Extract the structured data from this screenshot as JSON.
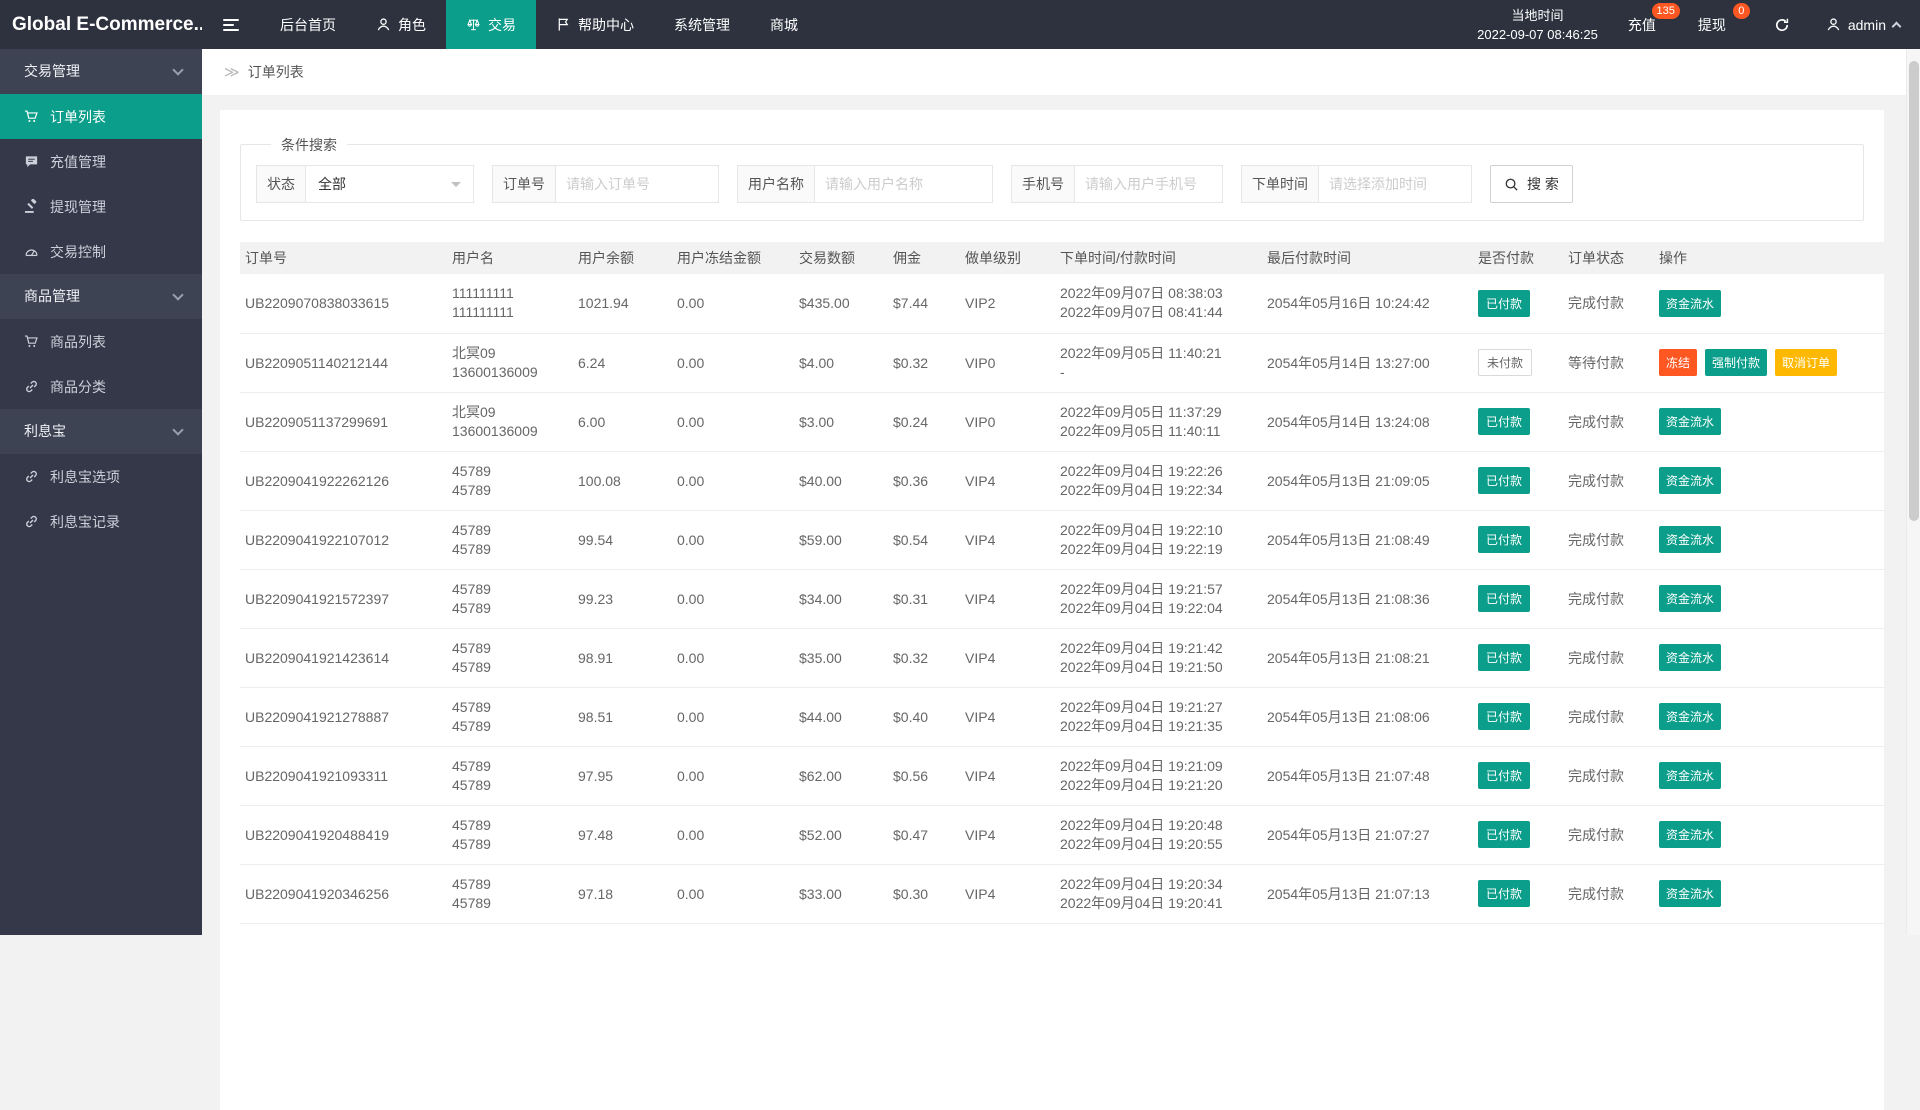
{
  "brand": "Global E-Commerce...",
  "colors": {
    "accent": "#0b9e8a",
    "danger": "#ff5722",
    "warning": "#ffb800",
    "header_bg": "#2d323e",
    "sidebar_bg": "#343848",
    "sidebar_group_bg": "#3e4354"
  },
  "topnav": {
    "items": [
      {
        "name": "dashboard",
        "label": "后台首页"
      },
      {
        "name": "roles",
        "label": "角色",
        "icon": "user"
      },
      {
        "name": "trade",
        "label": "交易",
        "icon": "scales",
        "active": true
      },
      {
        "name": "help-center",
        "label": "帮助中心",
        "icon": "flag"
      },
      {
        "name": "system",
        "label": "系统管理"
      },
      {
        "name": "mall",
        "label": "商城"
      }
    ],
    "local_time_label": "当地时间",
    "local_time": "2022-09-07 08:46:25",
    "recharge": {
      "label": "充值",
      "badge": "135"
    },
    "withdraw": {
      "label": "提现",
      "badge": "0"
    },
    "user": "admin"
  },
  "sidebar": {
    "items": [
      {
        "kind": "group",
        "name": "trade-management",
        "label": "交易管理"
      },
      {
        "kind": "leaf",
        "name": "order-list",
        "label": "订单列表",
        "icon": "cart",
        "active": true
      },
      {
        "kind": "leaf",
        "name": "recharge-management",
        "label": "充值管理",
        "icon": "comment"
      },
      {
        "kind": "leaf",
        "name": "withdraw-management",
        "label": "提现管理",
        "icon": "hammer"
      },
      {
        "kind": "leaf",
        "name": "trade-control",
        "label": "交易控制",
        "icon": "gauge"
      },
      {
        "kind": "group",
        "name": "goods-management",
        "label": "商品管理"
      },
      {
        "kind": "leaf",
        "name": "goods-list",
        "label": "商品列表",
        "icon": "cart"
      },
      {
        "kind": "leaf",
        "name": "goods-category",
        "label": "商品分类",
        "icon": "link"
      },
      {
        "kind": "group",
        "name": "interest-treasure",
        "label": "利息宝"
      },
      {
        "kind": "leaf",
        "name": "interest-options",
        "label": "利息宝选项",
        "icon": "link"
      },
      {
        "kind": "leaf",
        "name": "interest-records",
        "label": "利息宝记录",
        "icon": "link"
      }
    ]
  },
  "breadcrumb": "订单列表",
  "filters": {
    "legend": "条件搜索",
    "status_label": "状态",
    "status_value": "全部",
    "order_label": "订单号",
    "order_placeholder": "请输入订单号",
    "user_label": "用户名称",
    "user_placeholder": "请输入用户名称",
    "phone_label": "手机号",
    "phone_placeholder": "请输入用户手机号",
    "time_label": "下单时间",
    "time_placeholder": "请选择添加时间",
    "search_label": "搜 索"
  },
  "table": {
    "columns": [
      "订单号",
      "用户名",
      "用户余额",
      "用户冻结金额",
      "交易数额",
      "佣金",
      "做单级别",
      "下单时间/付款时间",
      "最后付款时间",
      "是否付款",
      "订单状态",
      "操作"
    ],
    "paid_labels": {
      "paid": "已付款",
      "unpaid": "未付款"
    },
    "rows": [
      {
        "order_no": "UB2209070838033615",
        "user": [
          "111111111",
          "111111111"
        ],
        "balance": "1021.94",
        "frozen": "0.00",
        "amount": "$435.00",
        "commission": "$7.44",
        "level": "VIP2",
        "times": [
          "2022年09月07日 08:38:03",
          "2022年09月07日 08:41:44"
        ],
        "last_pay": "2054年05月16日 10:24:42",
        "paid": "paid",
        "status": "完成付款",
        "actions": [
          {
            "name": "funds-flow",
            "label": "资金流水",
            "color": "teal"
          }
        ]
      },
      {
        "order_no": "UB2209051140212144",
        "user": [
          "北冥09",
          "13600136009"
        ],
        "balance": "6.24",
        "frozen": "0.00",
        "amount": "$4.00",
        "commission": "$0.32",
        "level": "VIP0",
        "times": [
          "2022年09月05日 11:40:21",
          "-"
        ],
        "last_pay": "2054年05月14日 13:27:00",
        "paid": "unpaid",
        "status": "等待付款",
        "actions": [
          {
            "name": "freeze",
            "label": "冻结",
            "color": "red"
          },
          {
            "name": "force-pay",
            "label": "强制付款",
            "color": "teal"
          },
          {
            "name": "cancel-order",
            "label": "取消订单",
            "color": "yellow"
          }
        ]
      },
      {
        "order_no": "UB2209051137299691",
        "user": [
          "北冥09",
          "13600136009"
        ],
        "balance": "6.00",
        "frozen": "0.00",
        "amount": "$3.00",
        "commission": "$0.24",
        "level": "VIP0",
        "times": [
          "2022年09月05日 11:37:29",
          "2022年09月05日 11:40:11"
        ],
        "last_pay": "2054年05月14日 13:24:08",
        "paid": "paid",
        "status": "完成付款",
        "actions": [
          {
            "name": "funds-flow",
            "label": "资金流水",
            "color": "teal"
          }
        ]
      },
      {
        "order_no": "UB2209041922262126",
        "user": [
          "45789",
          "45789"
        ],
        "balance": "100.08",
        "frozen": "0.00",
        "amount": "$40.00",
        "commission": "$0.36",
        "level": "VIP4",
        "times": [
          "2022年09月04日 19:22:26",
          "2022年09月04日 19:22:34"
        ],
        "last_pay": "2054年05月13日 21:09:05",
        "paid": "paid",
        "status": "完成付款",
        "actions": [
          {
            "name": "funds-flow",
            "label": "资金流水",
            "color": "teal"
          }
        ]
      },
      {
        "order_no": "UB2209041922107012",
        "user": [
          "45789",
          "45789"
        ],
        "balance": "99.54",
        "frozen": "0.00",
        "amount": "$59.00",
        "commission": "$0.54",
        "level": "VIP4",
        "times": [
          "2022年09月04日 19:22:10",
          "2022年09月04日 19:22:19"
        ],
        "last_pay": "2054年05月13日 21:08:49",
        "paid": "paid",
        "status": "完成付款",
        "actions": [
          {
            "name": "funds-flow",
            "label": "资金流水",
            "color": "teal"
          }
        ]
      },
      {
        "order_no": "UB2209041921572397",
        "user": [
          "45789",
          "45789"
        ],
        "balance": "99.23",
        "frozen": "0.00",
        "amount": "$34.00",
        "commission": "$0.31",
        "level": "VIP4",
        "times": [
          "2022年09月04日 19:21:57",
          "2022年09月04日 19:22:04"
        ],
        "last_pay": "2054年05月13日 21:08:36",
        "paid": "paid",
        "status": "完成付款",
        "actions": [
          {
            "name": "funds-flow",
            "label": "资金流水",
            "color": "teal"
          }
        ]
      },
      {
        "order_no": "UB2209041921423614",
        "user": [
          "45789",
          "45789"
        ],
        "balance": "98.91",
        "frozen": "0.00",
        "amount": "$35.00",
        "commission": "$0.32",
        "level": "VIP4",
        "times": [
          "2022年09月04日 19:21:42",
          "2022年09月04日 19:21:50"
        ],
        "last_pay": "2054年05月13日 21:08:21",
        "paid": "paid",
        "status": "完成付款",
        "actions": [
          {
            "name": "funds-flow",
            "label": "资金流水",
            "color": "teal"
          }
        ]
      },
      {
        "order_no": "UB2209041921278887",
        "user": [
          "45789",
          "45789"
        ],
        "balance": "98.51",
        "frozen": "0.00",
        "amount": "$44.00",
        "commission": "$0.40",
        "level": "VIP4",
        "times": [
          "2022年09月04日 19:21:27",
          "2022年09月04日 19:21:35"
        ],
        "last_pay": "2054年05月13日 21:08:06",
        "paid": "paid",
        "status": "完成付款",
        "actions": [
          {
            "name": "funds-flow",
            "label": "资金流水",
            "color": "teal"
          }
        ]
      },
      {
        "order_no": "UB2209041921093311",
        "user": [
          "45789",
          "45789"
        ],
        "balance": "97.95",
        "frozen": "0.00",
        "amount": "$62.00",
        "commission": "$0.56",
        "level": "VIP4",
        "times": [
          "2022年09月04日 19:21:09",
          "2022年09月04日 19:21:20"
        ],
        "last_pay": "2054年05月13日 21:07:48",
        "paid": "paid",
        "status": "完成付款",
        "actions": [
          {
            "name": "funds-flow",
            "label": "资金流水",
            "color": "teal"
          }
        ]
      },
      {
        "order_no": "UB2209041920488419",
        "user": [
          "45789",
          "45789"
        ],
        "balance": "97.48",
        "frozen": "0.00",
        "amount": "$52.00",
        "commission": "$0.47",
        "level": "VIP4",
        "times": [
          "2022年09月04日 19:20:48",
          "2022年09月04日 19:20:55"
        ],
        "last_pay": "2054年05月13日 21:07:27",
        "paid": "paid",
        "status": "完成付款",
        "actions": [
          {
            "name": "funds-flow",
            "label": "资金流水",
            "color": "teal"
          }
        ]
      },
      {
        "order_no": "UB2209041920346256",
        "user": [
          "45789",
          "45789"
        ],
        "balance": "97.18",
        "frozen": "0.00",
        "amount": "$33.00",
        "commission": "$0.30",
        "level": "VIP4",
        "times": [
          "2022年09月04日 19:20:34",
          "2022年09月04日 19:20:41"
        ],
        "last_pay": "2054年05月13日 21:07:13",
        "paid": "paid",
        "status": "完成付款",
        "actions": [
          {
            "name": "funds-flow",
            "label": "资金流水",
            "color": "teal"
          }
        ]
      }
    ]
  }
}
